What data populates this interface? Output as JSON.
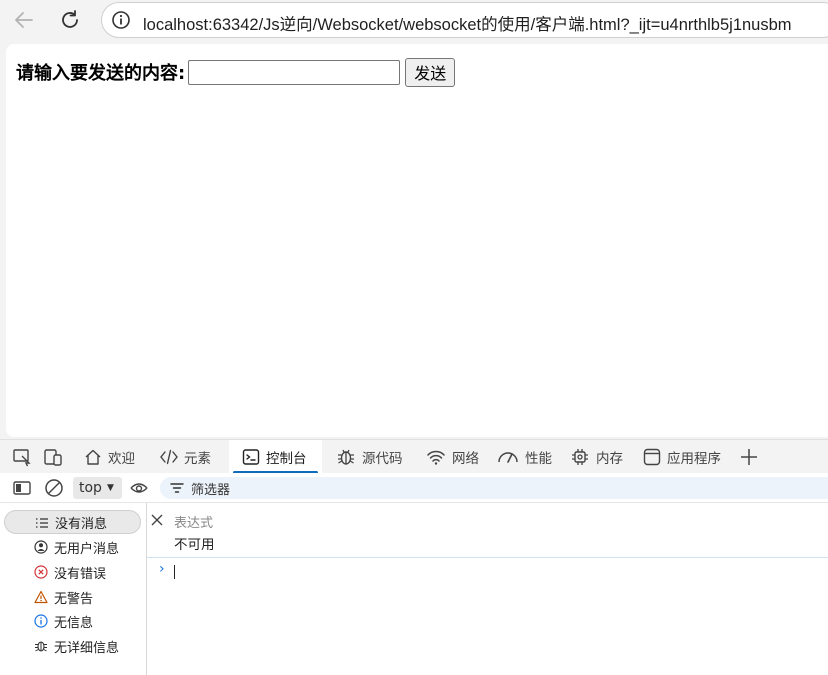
{
  "browser": {
    "url": "localhost:63342/Js逆向/Websocket/websocket的使用/客户端.html?_ijt=u4nrthlb5j1nusbm"
  },
  "page": {
    "label": "请输入要发送的内容:",
    "input_value": "",
    "send_label": "发送"
  },
  "devtools": {
    "tabs": [
      {
        "label": "欢迎",
        "icon": "home-icon"
      },
      {
        "label": "元素",
        "icon": "code-icon"
      },
      {
        "label": "控制台",
        "icon": "console-icon"
      },
      {
        "label": "源代码",
        "icon": "bug-icon"
      },
      {
        "label": "网络",
        "icon": "wifi-icon"
      },
      {
        "label": "性能",
        "icon": "gauge-icon"
      },
      {
        "label": "内存",
        "icon": "chip-icon"
      },
      {
        "label": "应用程序",
        "icon": "app-icon"
      }
    ],
    "active_tab": "控制台",
    "context": "top",
    "filter_label": "筛选器",
    "sidebar": [
      {
        "label": "没有消息",
        "icon": "list-icon"
      },
      {
        "label": "无用户消息",
        "icon": "user-icon"
      },
      {
        "label": "没有错误",
        "icon": "error-icon"
      },
      {
        "label": "无警告",
        "icon": "warning-icon"
      },
      {
        "label": "无信息",
        "icon": "info-icon"
      },
      {
        "label": "无详细信息",
        "icon": "bug-icon"
      }
    ],
    "expression_placeholder": "表达式",
    "expression_value": "不可用",
    "prompt_symbol": "›"
  },
  "colors": {
    "accent": "#0f6cbd",
    "error": "#d13438",
    "warning": "#c25400",
    "info": "#1a73e8"
  }
}
